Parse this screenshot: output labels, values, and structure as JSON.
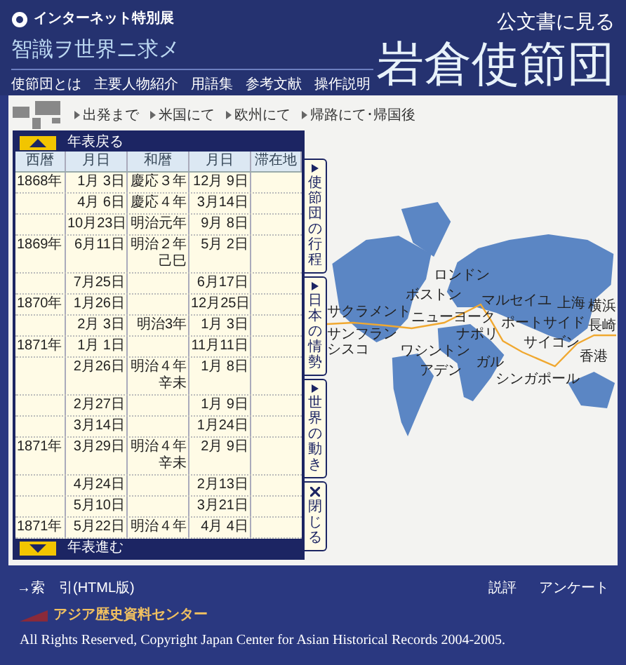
{
  "header": {
    "exhibit": "インターネット特別展",
    "motto": "智識ヲ世界ニ求メ",
    "subtitle": "公文書に見る",
    "title": "岩倉使節団",
    "nav": [
      "使節団とは",
      "主要人物紹介",
      "用語集",
      "参考文献",
      "操作説明"
    ]
  },
  "route_nav": [
    "出発まで",
    "米国にて",
    "欧州にて",
    "帰路にて･帰国後"
  ],
  "timeline": {
    "back": "年表戻る",
    "forward": "年表進む",
    "columns": [
      "西暦",
      "月日",
      "和暦",
      "月日",
      "滞在地"
    ],
    "rows": [
      {
        "year": "1868年",
        "date": "1月 3日",
        "era": "慶応３年",
        "era_sub": "",
        "lunar": "12月 9日"
      },
      {
        "year": "",
        "date": "4月 6日",
        "era": "慶応４年",
        "era_sub": "",
        "lunar": "3月14日"
      },
      {
        "year": "",
        "date": "10月23日",
        "era": "明治元年",
        "era_sub": "",
        "lunar": "9月 8日"
      },
      {
        "year": "1869年",
        "date": "6月11日",
        "era": "明治２年",
        "era_sub": "己巳",
        "lunar": "5月 2日"
      },
      {
        "year": "",
        "date": "7月25日",
        "era": "",
        "era_sub": "",
        "lunar": "6月17日"
      },
      {
        "year": "1870年",
        "date": "1月26日",
        "era": "",
        "era_sub": "",
        "lunar": "12月25日"
      },
      {
        "year": "",
        "date": "2月 3日",
        "era": "明治3年",
        "era_sub": "",
        "lunar": "1月 3日"
      },
      {
        "year": "1871年",
        "date": "1月 1日",
        "era": "",
        "era_sub": "",
        "lunar": "11月11日"
      },
      {
        "year": "",
        "date": "2月26日",
        "era": "明治４年",
        "era_sub": "辛未",
        "lunar": "1月 8日"
      },
      {
        "year": "",
        "date": "2月27日",
        "era": "",
        "era_sub": "",
        "lunar": "1月 9日"
      },
      {
        "year": "",
        "date": "3月14日",
        "era": "",
        "era_sub": "",
        "lunar": "1月24日"
      },
      {
        "year": "1871年",
        "date": "3月29日",
        "era": "明治４年",
        "era_sub": "辛未",
        "lunar": "2月 9日"
      },
      {
        "year": "",
        "date": "4月24日",
        "era": "",
        "era_sub": "",
        "lunar": "2月13日"
      },
      {
        "year": "",
        "date": "5月10日",
        "era": "",
        "era_sub": "",
        "lunar": "3月21日"
      },
      {
        "year": "1871年",
        "date": "5月22日",
        "era": "明治４年",
        "era_sub": "",
        "lunar": "4月 4日"
      }
    ]
  },
  "side_tabs": [
    {
      "kind": "open",
      "label": "使節団の行程"
    },
    {
      "kind": "open",
      "label": "日本の情勢"
    },
    {
      "kind": "open",
      "label": "世界の動き"
    },
    {
      "kind": "close",
      "label": "閉じる"
    }
  ],
  "map": {
    "labels": [
      "ロンドン",
      "ボストン",
      "マルセイユ",
      "上海",
      "横浜",
      "サクラメント",
      "ニューヨーク",
      "ポートサイド",
      "長崎",
      "サンフランシスコ",
      "ナポリ",
      "サイゴン",
      "ワシントン",
      "香港",
      "ガル",
      "アデン",
      "シンガポール"
    ]
  },
  "footer": {
    "index_link": "→索　引(HTML版)",
    "links": [
      "説評",
      "アンケート"
    ],
    "org": "アジア歴史資料センター",
    "copyright": "All Rights Reserved, Copyright Japan Center for Asian Historical Records 2004-2005."
  }
}
